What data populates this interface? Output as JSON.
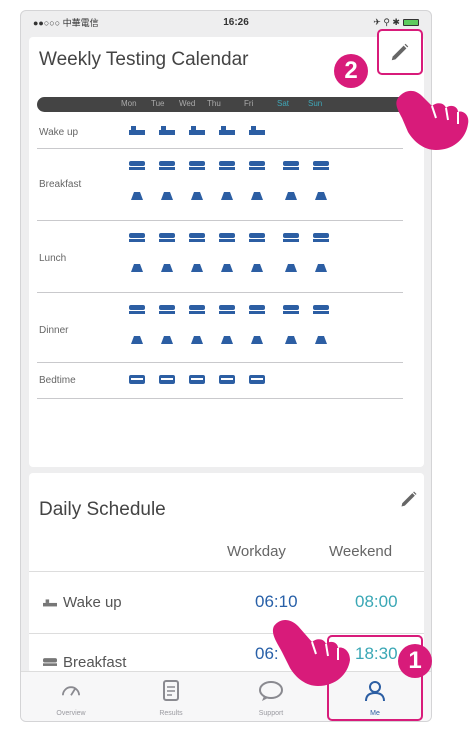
{
  "status_bar": {
    "carrier": "●●○○○ 中華電信 ",
    "time": "16:26",
    "right": "✈ ⚲ ✱"
  },
  "calendar": {
    "title": "Weekly Testing Calendar",
    "days": [
      "Mon",
      "Tue",
      "Wed",
      "Thu",
      "Fri",
      "Sat",
      "Sun"
    ],
    "rows": [
      {
        "label": "Wake up",
        "days_active": 5
      },
      {
        "label": "Breakfast",
        "days_active": 7
      },
      {
        "label": "Lunch",
        "days_active": 7
      },
      {
        "label": "Dinner",
        "days_active": 7
      },
      {
        "label": "Bedtime",
        "days_active": 5
      }
    ]
  },
  "schedule": {
    "title": "Daily Schedule",
    "col_workday": "Workday",
    "col_weekend": "Weekend",
    "rows": [
      {
        "label": "Wake up",
        "workday": "06:10",
        "weekend": "08:00"
      },
      {
        "label": "Breakfast",
        "workday": "06:",
        "weekend": "18:30"
      }
    ]
  },
  "tabs": [
    {
      "label": "Overview",
      "icon": "gauge-icon"
    },
    {
      "label": "Results",
      "icon": "document-icon"
    },
    {
      "label": "Support",
      "icon": "chat-bubble-icon"
    },
    {
      "label": "Me",
      "icon": "person-icon"
    }
  ],
  "annotations": {
    "badge_1": "1",
    "badge_2": "2"
  },
  "colors": {
    "accent_pink": "#d81b7a",
    "workday_blue": "#2860a8",
    "weekend_teal": "#3aa7b5",
    "icon_blue": "#2c5ea3"
  }
}
